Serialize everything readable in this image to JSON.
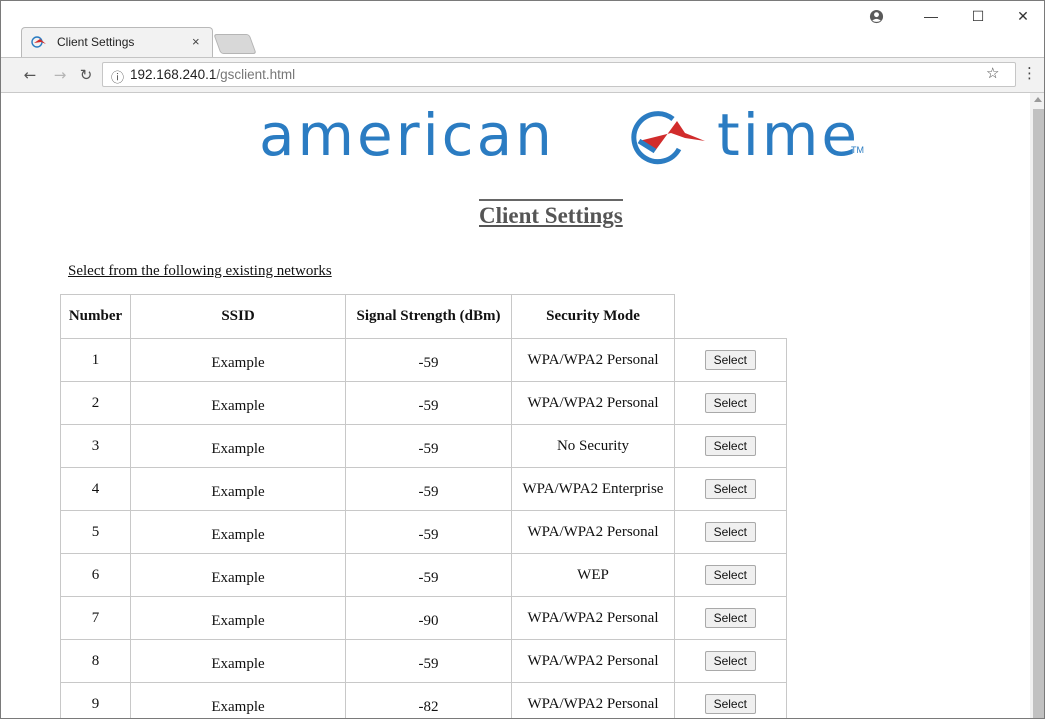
{
  "browser": {
    "tab_title": "Client Settings",
    "tab_close": "×",
    "url_host": "192.168.240.1",
    "url_path": "/gsclient.html",
    "icons": [
      "back-icon",
      "forward-icon",
      "reload-icon",
      "info-icon",
      "star-icon",
      "menu-icon",
      "profile-icon"
    ],
    "window_controls": {
      "minimize": "—",
      "maximize": "☐",
      "close": "✕"
    }
  },
  "logo": {
    "left_word": "american",
    "right_word": "time",
    "tm": "TM",
    "brand_blue": "#2b7cc2",
    "brand_red": "#d12c2c"
  },
  "page": {
    "title": "Client Settings",
    "instruction": "Select from the following existing networks"
  },
  "table": {
    "headers": [
      "Number",
      "SSID",
      "Signal Strength (dBm)",
      "Security Mode"
    ],
    "select_label": "Select",
    "rows": [
      {
        "number": "1",
        "ssid": "Example",
        "signal": "-59",
        "security": "WPA/WPA2 Personal"
      },
      {
        "number": "2",
        "ssid": "Example",
        "signal": "-59",
        "security": "WPA/WPA2 Personal"
      },
      {
        "number": "3",
        "ssid": "Example",
        "signal": "-59",
        "security": "No Security"
      },
      {
        "number": "4",
        "ssid": "Example",
        "signal": "-59",
        "security": "WPA/WPA2 Enterprise"
      },
      {
        "number": "5",
        "ssid": "Example",
        "signal": "-59",
        "security": "WPA/WPA2 Personal"
      },
      {
        "number": "6",
        "ssid": "Example",
        "signal": "-59",
        "security": "WEP"
      },
      {
        "number": "7",
        "ssid": "Example",
        "signal": "-90",
        "security": "WPA/WPA2 Personal"
      },
      {
        "number": "8",
        "ssid": "Example",
        "signal": "-59",
        "security": "WPA/WPA2 Personal"
      },
      {
        "number": "9",
        "ssid": "Example",
        "signal": "-82",
        "security": "WPA/WPA2 Personal"
      }
    ]
  }
}
